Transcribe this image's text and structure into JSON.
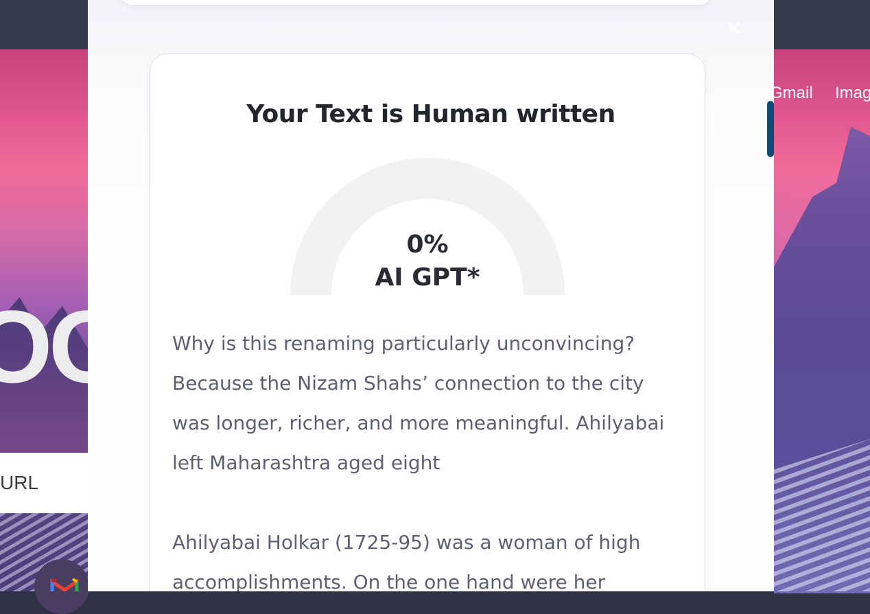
{
  "background": {
    "links": [
      "Gmail",
      "Imag"
    ],
    "search_placeholder_fragment": "URL",
    "logo_fragment": "OO"
  },
  "modal": {
    "title": "Your Text is Human written",
    "gauge": {
      "value_text": "0%",
      "value_fraction": 0,
      "label": "AI GPT*"
    },
    "paragraphs": [
      "Why is this renaming particularly unconvincing? Because the Nizam Shahs’ connection to the city was longer, richer, and more meaningful. Ahilyabai left Maharashtra aged eight",
      "Ahilyabai Holkar (1725-95) was a woman of high accomplishments. On the one hand were her"
    ]
  },
  "colors": {
    "title_text": "#23252e",
    "body_text": "#5c6072",
    "gauge_track": "#f2f2f4",
    "scroll_thumb": "#0d4b73"
  },
  "icons": {
    "close": "close-icon",
    "gmail": "gmail-icon"
  }
}
